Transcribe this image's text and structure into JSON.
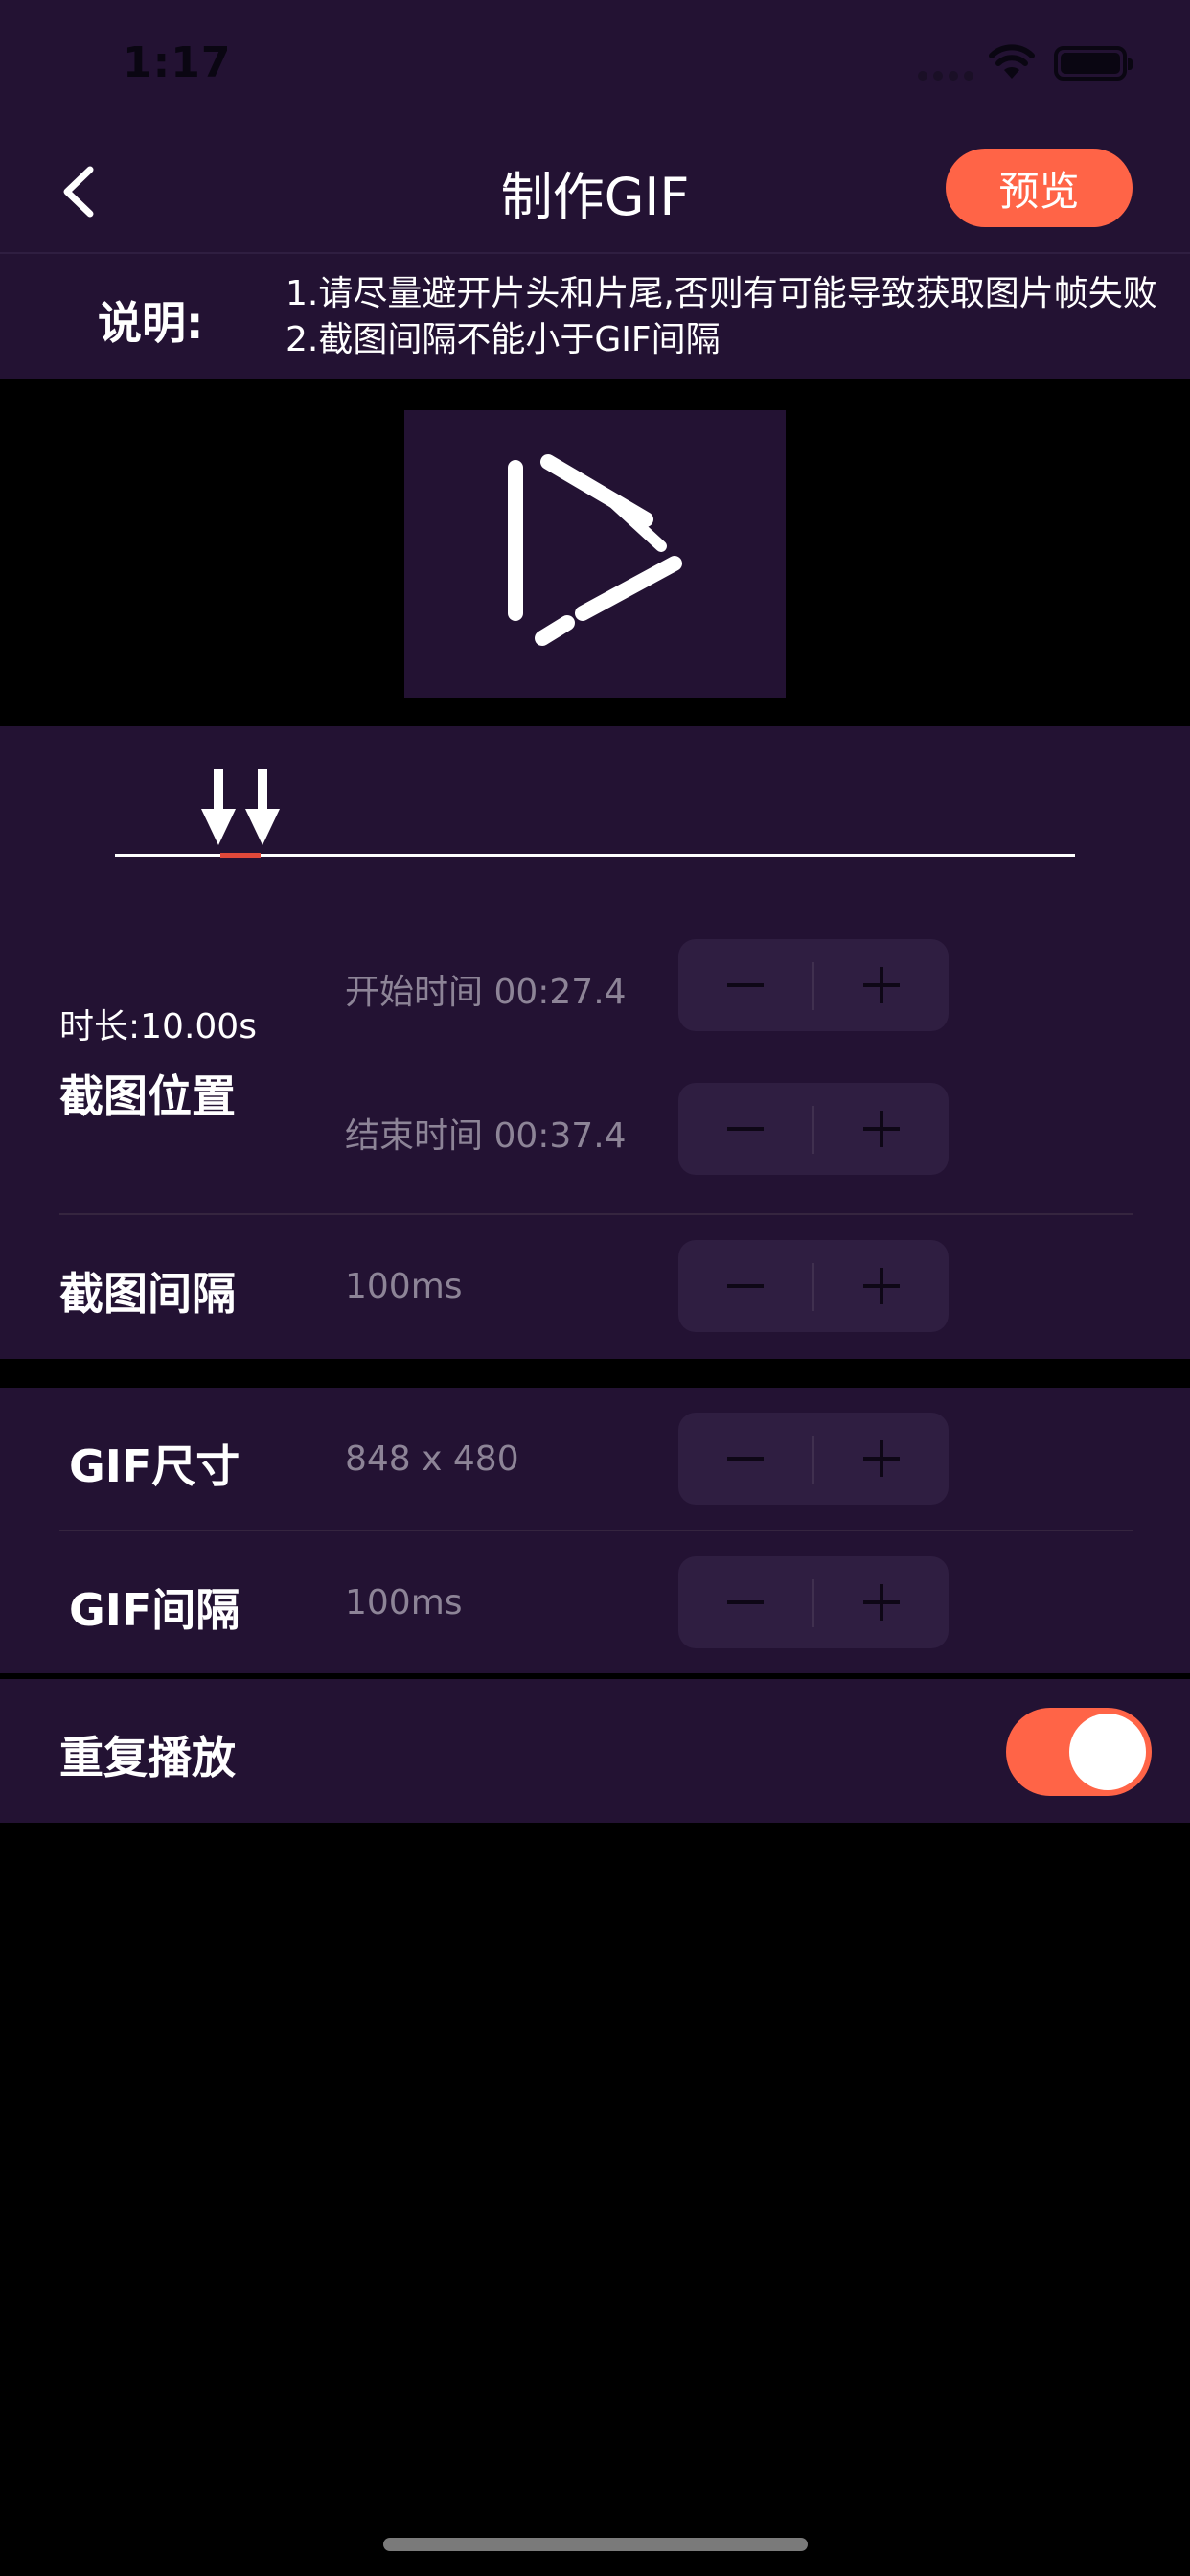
{
  "status": {
    "time": "1:17"
  },
  "nav": {
    "title": "制作GIF",
    "preview_label": "预览"
  },
  "instructions": {
    "label": "说明:",
    "line1": "1.请尽量避开片头和片尾,否则有可能导致获取图片帧失败",
    "line2": "2.截图间隔不能小于GIF间隔"
  },
  "clip": {
    "duration": "时长:10.00s",
    "position_label": "截图位置",
    "start_time": "开始时间 00:27.4",
    "end_time": "结束时间 00:37.4",
    "interval_label": "截图间隔",
    "interval_value": "100ms"
  },
  "gif": {
    "size_label": "GIF尺寸",
    "size_value": "848 x 480",
    "interval_label": "GIF间隔",
    "interval_value": "100ms"
  },
  "repeat": {
    "label": "重复播放",
    "enabled": true
  },
  "colors": {
    "accent": "#ff6447",
    "panel": "#231233",
    "stepper": "#2f1e41",
    "muted_text": "#8d8497"
  }
}
